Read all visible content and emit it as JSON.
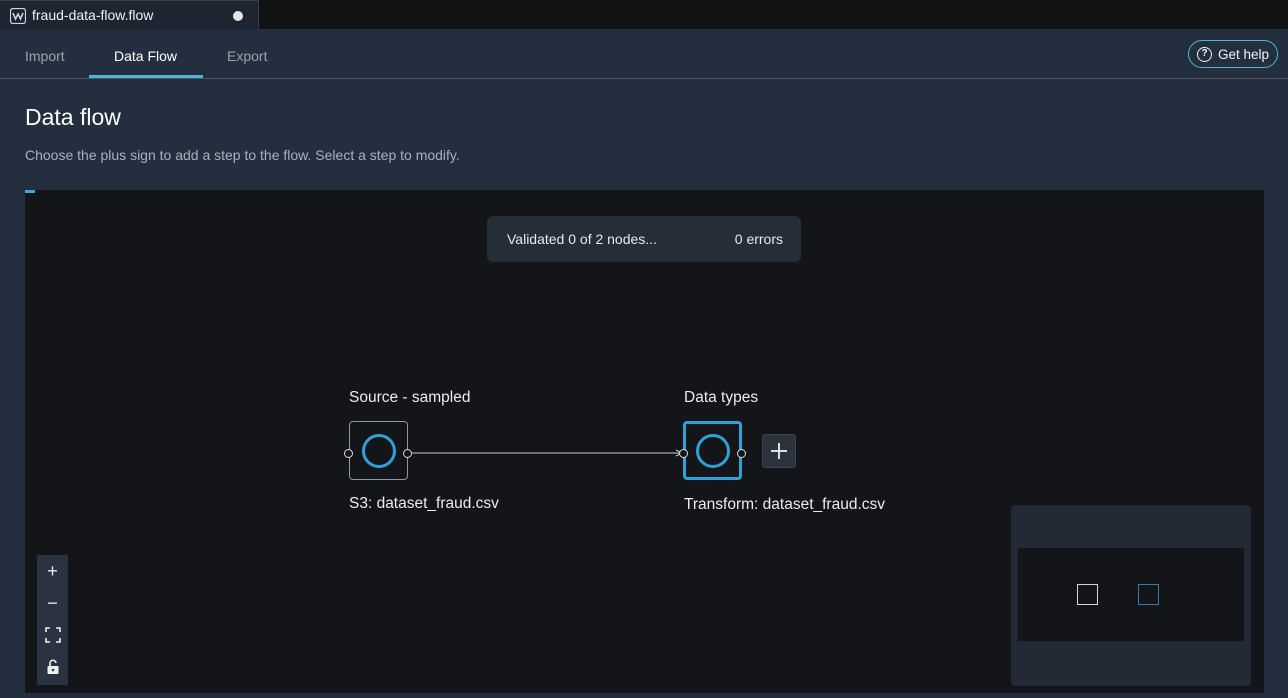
{
  "editor": {
    "file_name": "fraud-data-flow.flow"
  },
  "nav": {
    "tabs": [
      {
        "label": "Import"
      },
      {
        "label": "Data Flow"
      },
      {
        "label": "Export"
      }
    ],
    "active_tab": "Data Flow",
    "help_label": "Get help"
  },
  "page": {
    "title": "Data flow",
    "description": "Choose the plus sign to add a step to the flow. Select a step to modify."
  },
  "validation": {
    "status": "Validated 0 of 2 nodes...",
    "errors": "0 errors"
  },
  "nodes": [
    {
      "title": "Source - sampled",
      "subtitle": "S3: dataset_fraud.csv",
      "selected": false
    },
    {
      "title": "Data types",
      "subtitle": "Transform: dataset_fraud.csv",
      "selected": true
    }
  ],
  "zoom_controls": {
    "zoom_in": "+",
    "zoom_out": "−"
  },
  "colors": {
    "accent": "#2ea1d6",
    "tab_underline": "#4fb3d6",
    "canvas": "#131519",
    "panel": "#232f3e"
  }
}
